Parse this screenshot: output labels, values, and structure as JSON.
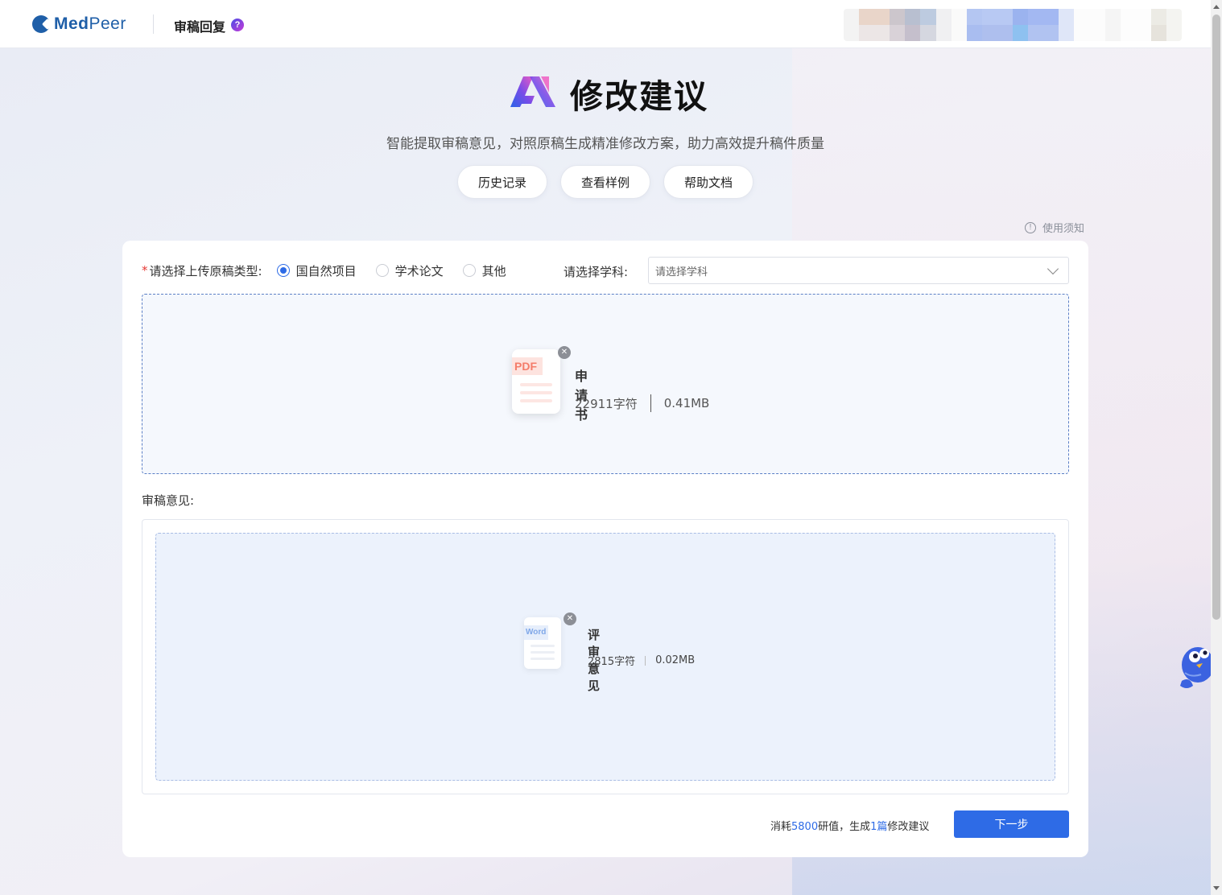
{
  "header": {
    "brand_bold": "Med",
    "brand_thin": "Peer",
    "title": "审稿回复",
    "help_glyph": "?"
  },
  "hero": {
    "title": "修改建议",
    "subtitle": "智能提取审稿意见，对照原稿生成精准修改方案，助力高效提升稿件质量",
    "buttons": [
      "历史记录",
      "查看样例",
      "帮助文档"
    ],
    "notice_label": "使用须知",
    "notice_glyph": "!"
  },
  "form": {
    "required_mark": "*",
    "type_label": "请选择上传原稿类型:",
    "type_options": [
      {
        "label": "国自然项目",
        "selected": true
      },
      {
        "label": "学术论文",
        "selected": false
      },
      {
        "label": "其他",
        "selected": false
      }
    ],
    "subject_label": "请选择学科:",
    "subject_placeholder": "请选择学科"
  },
  "manuscript_file": {
    "badge": "PDF",
    "name": "申请书",
    "chars": "22911字符",
    "size": "0.41MB"
  },
  "review": {
    "label": "审稿意见:",
    "file": {
      "badge": "Word",
      "name": "评审意见",
      "chars": "2815字符",
      "size": "0.02MB"
    }
  },
  "footer": {
    "cost_prefix": "消耗",
    "cost_value": "5800",
    "cost_mid": "研值，生成",
    "count_value": "1篇",
    "cost_suffix": "修改建议",
    "next_label": "下一步"
  },
  "colors": {
    "accent": "#2e6be6",
    "brand": "#1f5fa8",
    "required": "#e53935",
    "pdf_badge": "#f47c6a",
    "word_badge": "#7fa7e8"
  },
  "icons": {
    "help": "help-icon",
    "notice": "info-icon",
    "close": "close-icon",
    "chevron": "chevron-down-icon",
    "assistant": "mascot-icon"
  }
}
